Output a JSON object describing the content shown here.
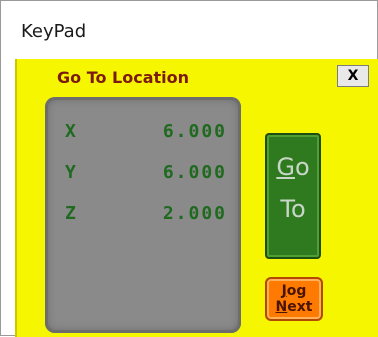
{
  "window": {
    "title": "KeyPad"
  },
  "dialog": {
    "title": "Go To Location",
    "close_label": "X"
  },
  "readout": {
    "axes": [
      {
        "label": "X",
        "value": "6.000"
      },
      {
        "label": "Y",
        "value": "6.000"
      },
      {
        "label": "Z",
        "value": "2.000"
      }
    ]
  },
  "goto_button": {
    "line1_accel": "G",
    "line1_rest": "o",
    "line2": "To"
  },
  "jog_button": {
    "line1_accel": "J",
    "line1_rest": "og",
    "line2_accel": "N",
    "line2_rest": "ext"
  },
  "colors": {
    "client_bg": "#f6f600",
    "readout_bg": "#8a8a8a",
    "digit_green": "#1f6a1f",
    "goto_green": "#2f7a1e",
    "jog_orange": "#ff7a00",
    "dialog_title": "#7a1a10"
  }
}
